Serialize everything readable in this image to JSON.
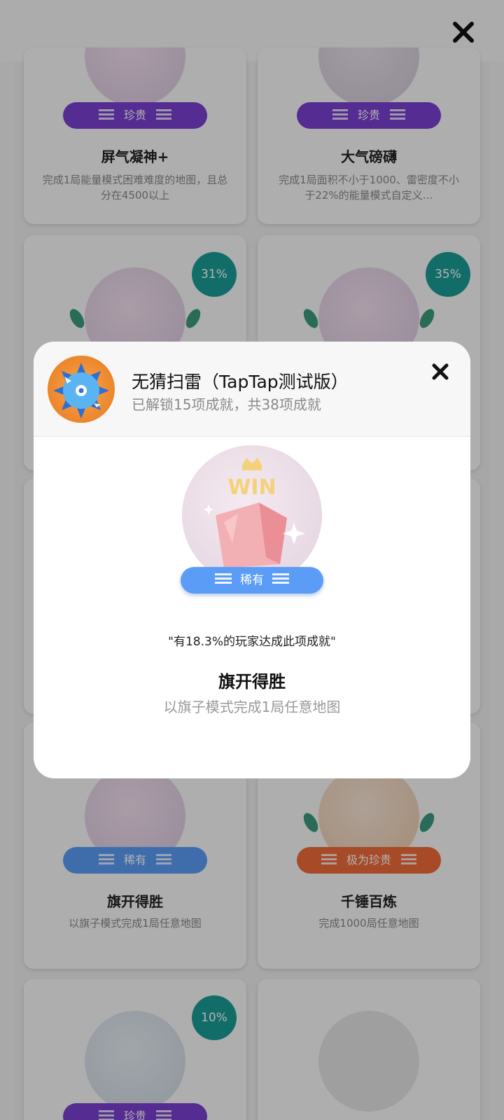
{
  "colors": {
    "purple_badge": "#7a3fd1",
    "blue_badge": "#5b9cf7",
    "orange_badge": "#f06a3a",
    "teal_percent": "#1a9c97"
  },
  "background": {
    "close_icon": "close-icon",
    "cards": [
      {
        "badge": "珍贵",
        "title": "屏气凝神+",
        "desc": "完成1局能量模式困难难度的地图，且总分在4500以上"
      },
      {
        "badge": "珍贵",
        "title": "大气磅礴",
        "desc": "完成1局面积不小于1000、雷密度不小于22%的能量模式自定义…"
      },
      {
        "percent": "31%"
      },
      {
        "percent": "35%"
      },
      {
        "badge": "稀有",
        "title": "旗开得胜",
        "desc": "以旗子模式完成1局任意地图"
      },
      {
        "badge": "极为珍贵",
        "title": "千锤百炼",
        "desc": "完成1000局任意地图"
      },
      {
        "percent": "10%",
        "badge": "珍贵"
      },
      {}
    ]
  },
  "dialog": {
    "app_title": "无猜扫雷（TapTap测试版）",
    "subtitle": "已解锁15项成就，共38项成就",
    "medal_text": "WIN",
    "rarity": "稀有",
    "percent_text": "\"有18.3%的玩家达成此项成就\"",
    "achievement_title": "旗开得胜",
    "achievement_desc": "以旗子模式完成1局任意地图"
  }
}
